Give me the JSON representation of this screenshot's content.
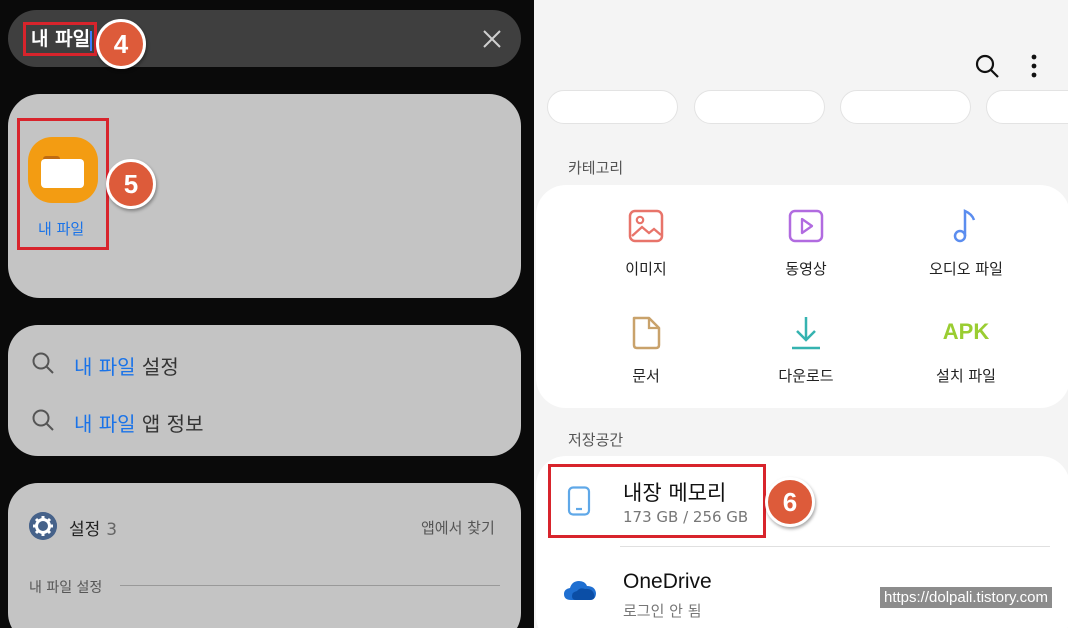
{
  "search": {
    "query": "내 파일",
    "clear_icon": "close-icon"
  },
  "steps": {
    "s4": "4",
    "s5": "5",
    "s6": "6"
  },
  "colors": {
    "highlight": "#d8242c",
    "badge": "#dd5b3a",
    "link_blue": "#1a73e8",
    "apk_green": "#9acd32"
  },
  "app_result": {
    "label": "내 파일",
    "icon": "folder-icon"
  },
  "suggestions": [
    {
      "hl": "내 파일",
      "rest": " 설정"
    },
    {
      "hl": "내 파일",
      "rest": " 앱 정보"
    }
  ],
  "settings_result": {
    "title": "설정",
    "count": "3",
    "find_in_app": "앱에서 찾기",
    "section": "내 파일 설정"
  },
  "myfiles": {
    "toolbar": {
      "search_icon": "search-icon",
      "more_icon": "more-vert-icon"
    },
    "category_heading": "카테고리",
    "categories": [
      {
        "label": "이미지",
        "icon": "image-icon",
        "color": "#e8746a"
      },
      {
        "label": "동영상",
        "icon": "video-icon",
        "color": "#b16be0"
      },
      {
        "label": "오디오 파일",
        "icon": "audio-icon",
        "color": "#5b8def"
      },
      {
        "label": "문서",
        "icon": "document-icon",
        "color": "#c9a26b"
      },
      {
        "label": "다운로드",
        "icon": "download-icon",
        "color": "#35b3b0"
      },
      {
        "label": "설치 파일",
        "icon": "apk-icon",
        "apk_text": "APK",
        "color": "#9acd32"
      }
    ],
    "storage_heading": "저장공간",
    "storage": [
      {
        "name": "내장 메모리",
        "detail": "173 GB / 256 GB",
        "icon": "phone-icon"
      },
      {
        "name": "OneDrive",
        "detail": "로그인 안 됨",
        "icon": "onedrive-icon"
      }
    ]
  },
  "watermark": "https://dolpali.tistory.com"
}
